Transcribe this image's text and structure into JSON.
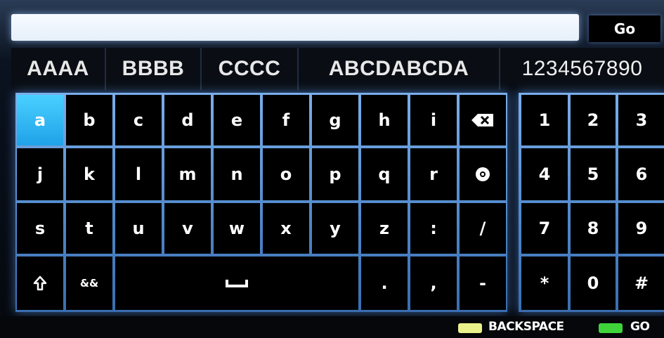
{
  "search": {
    "value": "",
    "go_label": "Go"
  },
  "suggestions": [
    "AAAA",
    "BBBB",
    "CCCC",
    "ABCDABCDA",
    "1234567890"
  ],
  "keyboard": {
    "row1": [
      "a",
      "b",
      "c",
      "d",
      "e",
      "f",
      "g",
      "h",
      "i"
    ],
    "row2": [
      "j",
      "k",
      "l",
      "m",
      "n",
      "o",
      "p",
      "q",
      "r"
    ],
    "row3": [
      "s",
      "t",
      "u",
      "v",
      "w",
      "x",
      "y",
      "z",
      ":",
      "/"
    ],
    "row4_symbols": [
      "&&"
    ],
    "row4_punct": [
      ".",
      ",",
      "-"
    ],
    "selected_key": "a",
    "icons": {
      "backspace": "backspace-icon",
      "at": "at-icon",
      "shift": "shift-icon",
      "space": "space-icon"
    }
  },
  "numpad": {
    "rows": [
      [
        "1",
        "2",
        "3"
      ],
      [
        "4",
        "5",
        "6"
      ],
      [
        "7",
        "8",
        "9"
      ],
      [
        "*",
        "0",
        "#"
      ]
    ]
  },
  "legend": {
    "backspace_label": "BACKSPACE",
    "go_label": "GO",
    "backspace_color": "#e9f28a",
    "go_color": "#3fd43a"
  },
  "colors": {
    "selected_key": "#29b6f6",
    "key_grid": "#5b8fd1",
    "search_glow": "#a0c8ff"
  }
}
